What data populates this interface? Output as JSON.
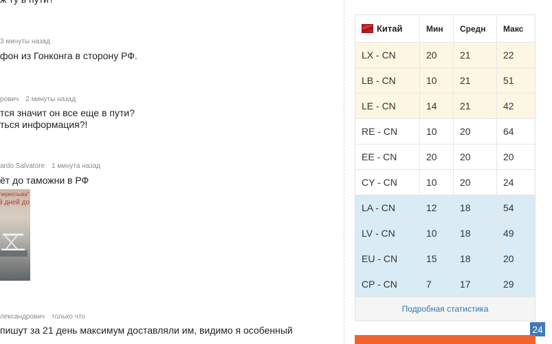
{
  "comments": [
    {
      "author": "",
      "time": "",
      "lines": [
        "ж ту в пути?"
      ]
    },
    {
      "author": "",
      "time": "3 минуты назад",
      "lines": [
        "фон из Гонконга в сторону РФ."
      ]
    },
    {
      "author": "рович",
      "time": "2 минуты назад",
      "lines": [
        "тся значит он все еще в пути?",
        "ться информация?!"
      ]
    },
    {
      "author": "ardo Salvatore",
      "time": "1 минута назад",
      "lines": [
        "ёт до таможни в РФ"
      ]
    },
    {
      "author": "лександрович",
      "time": "только что",
      "lines": [
        "пишут за 21 день максимум доставляли им, видимо я особенный"
      ]
    }
  ],
  "thumbnail": {
    "caption_top": "-переплыва\"",
    "caption_main": "3 дней до"
  },
  "stats": {
    "country": "Китай",
    "headers": {
      "min": "Мин",
      "avg": "Средн",
      "max": "Макс"
    },
    "rows": [
      {
        "route": "LX - CN",
        "min": "20",
        "avg": "21",
        "max": "22",
        "tone": "y"
      },
      {
        "route": "LB - CN",
        "min": "10",
        "avg": "21",
        "max": "51",
        "tone": "y"
      },
      {
        "route": "LE - CN",
        "min": "14",
        "avg": "21",
        "max": "42",
        "tone": "y"
      },
      {
        "route": "RE - CN",
        "min": "10",
        "avg": "20",
        "max": "64",
        "tone": "w"
      },
      {
        "route": "EE - CN",
        "min": "20",
        "avg": "20",
        "max": "20",
        "tone": "w"
      },
      {
        "route": "CY - CN",
        "min": "10",
        "avg": "20",
        "max": "24",
        "tone": "w"
      },
      {
        "route": "LA - CN",
        "min": "12",
        "avg": "18",
        "max": "54",
        "tone": "b"
      },
      {
        "route": "LV - CN",
        "min": "10",
        "avg": "18",
        "max": "49",
        "tone": "b"
      },
      {
        "route": "EU - CN",
        "min": "15",
        "avg": "18",
        "max": "20",
        "tone": "b"
      },
      {
        "route": "CP - CN",
        "min": "7",
        "avg": "17",
        "max": "29",
        "tone": "b"
      }
    ],
    "footer_link": "Подробная статистика"
  },
  "badge": "24",
  "colors": {
    "yellow_row": "#fcf6e2",
    "blue_row": "#d9ebf5",
    "link": "#2e75b6",
    "accent": "#f2622b"
  }
}
